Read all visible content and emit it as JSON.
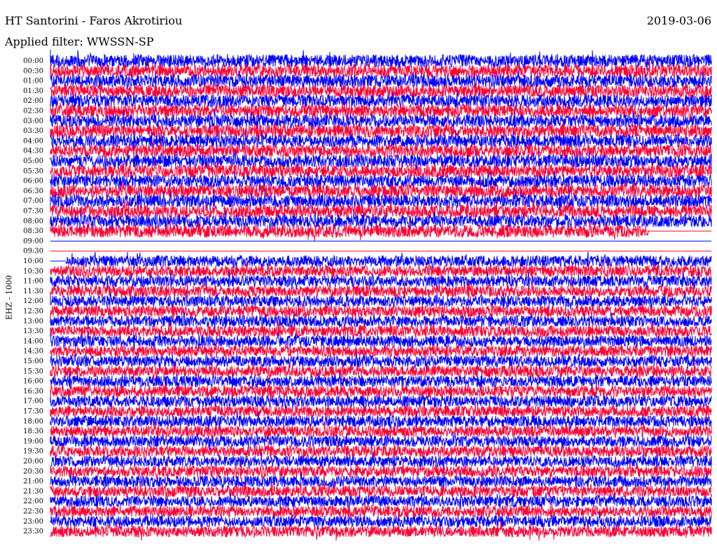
{
  "header": {
    "station_title": "HT Santorini - Faros Akrotiriou",
    "date": "2019-03-06",
    "filter_label": "Applied filter: WWSSN-SP",
    "channel_label": "EHZ - 1000"
  },
  "colors": {
    "trace_a": "#0000ff",
    "trace_b": "#ff0033",
    "background": "#ffffff",
    "text": "#000000"
  },
  "chart_data": {
    "type": "line",
    "title": "HT Santorini - Faros Akrotiriou",
    "subtitle": "Applied filter: WWSSN-SP",
    "ylabel": "EHZ - 1000",
    "xlabel": "",
    "row_labels": [
      "00:00",
      "00:30",
      "01:00",
      "01:30",
      "02:00",
      "02:30",
      "03:00",
      "03:30",
      "04:00",
      "04:30",
      "05:00",
      "05:30",
      "06:00",
      "06:30",
      "07:00",
      "07:30",
      "08:00",
      "08:30",
      "09:00",
      "09:30",
      "10:00",
      "10:30",
      "11:00",
      "11:30",
      "12:00",
      "12:30",
      "13:00",
      "13:30",
      "14:00",
      "14:30",
      "15:00",
      "15:30",
      "16:00",
      "16:30",
      "17:00",
      "17:30",
      "18:00",
      "18:30",
      "19:00",
      "19:30",
      "20:00",
      "20:30",
      "21:00",
      "21:30",
      "22:00",
      "22:30",
      "23:00",
      "23:30"
    ],
    "data_gap": {
      "start": "09:00",
      "end": "10:00"
    },
    "series_colors_alternate": [
      "#0000ff",
      "#ff0033"
    ],
    "grid": false,
    "legend": "none"
  }
}
